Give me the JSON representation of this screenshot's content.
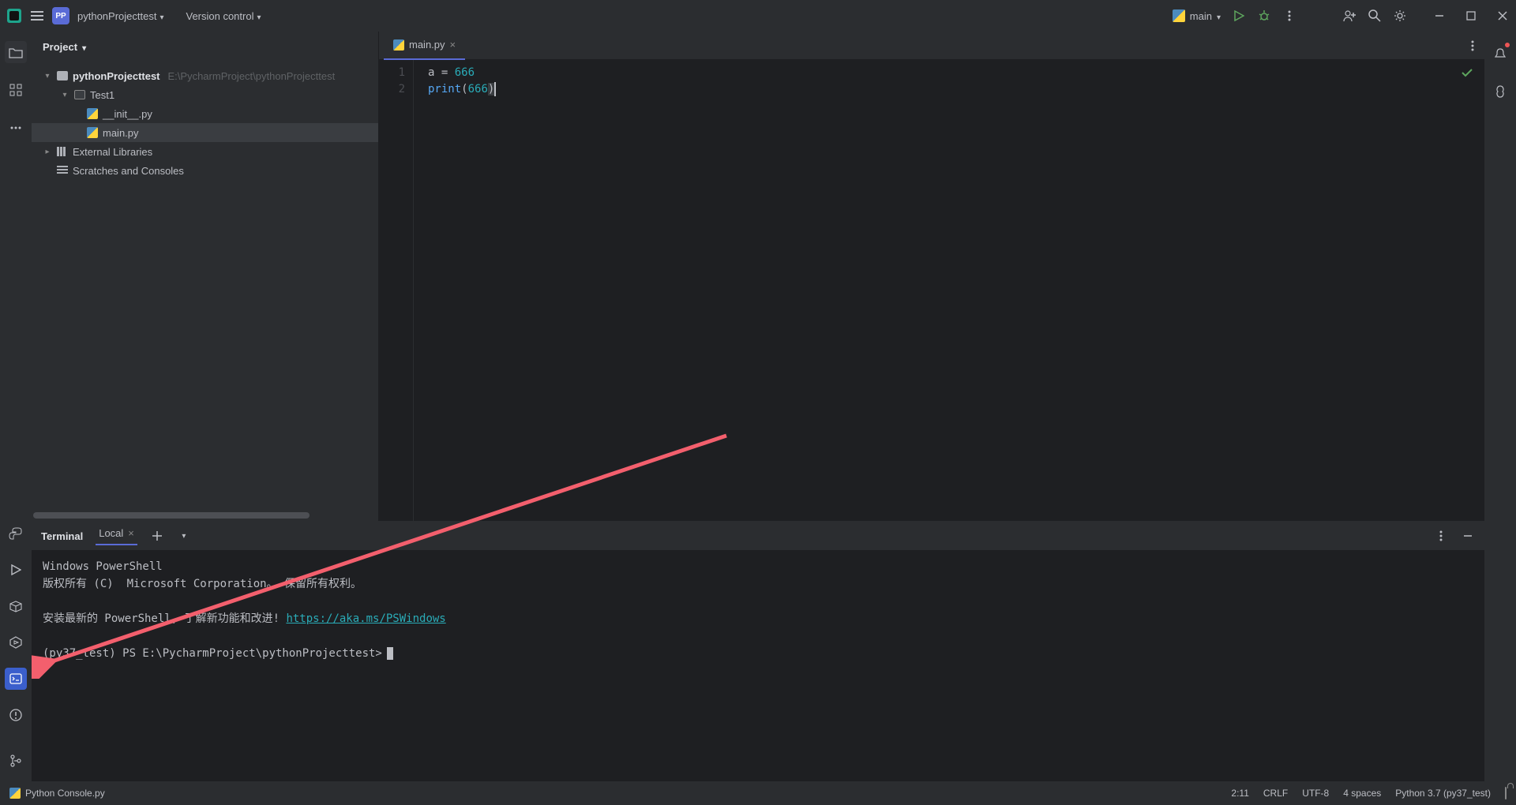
{
  "titlebar": {
    "pp_badge": "PP",
    "project_name": "pythonProjecttest",
    "vcs_label": "Version control",
    "run_config": "main"
  },
  "project": {
    "title": "Project",
    "root_name": "pythonProjecttest",
    "root_path": "E:\\PycharmProject\\pythonProjecttest",
    "test_folder": "Test1",
    "init_file": "__init__.py",
    "main_file": "main.py",
    "external_libs": "External Libraries",
    "scratches": "Scratches and Consoles"
  },
  "editor": {
    "tab_name": "main.py",
    "lines": {
      "l1": {
        "num": "1",
        "var": "a",
        "eq": " = ",
        "lit": "666"
      },
      "l2": {
        "num": "2",
        "fn": "print",
        "lp": "(",
        "arg": "666",
        "rp": ")"
      }
    }
  },
  "terminal": {
    "title": "Terminal",
    "tab": "Local",
    "lines": {
      "l1": "Windows PowerShell",
      "l2": "版权所有 (C)  Microsoft Corporation。 保留所有权利。",
      "l3a": "安装最新的 PowerShell, 了解新功能和改进! ",
      "l3link": "https://aka.ms/PSWindows",
      "l4": "(py37_test) PS E:\\PycharmProject\\pythonProjecttest>"
    }
  },
  "statusbar": {
    "console_file": "Python Console.py",
    "pos": "2:11",
    "line_sep": "CRLF",
    "encoding": "UTF-8",
    "indent": "4 spaces",
    "interpreter": "Python 3.7 (py37_test)"
  }
}
